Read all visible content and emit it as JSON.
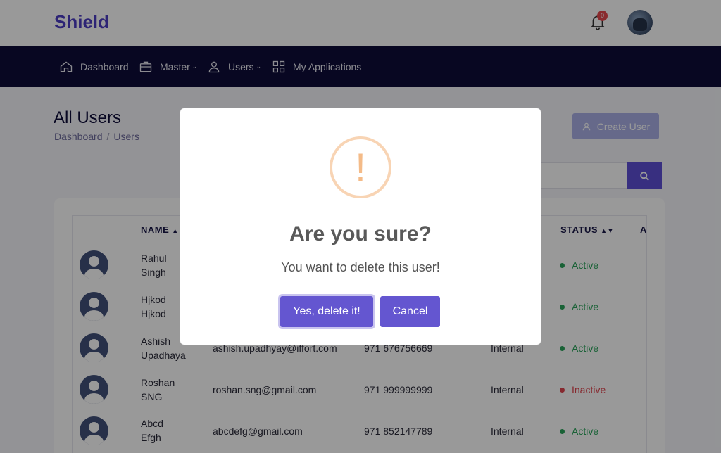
{
  "header": {
    "brand": "Shield",
    "notification_count": "0"
  },
  "nav": {
    "items": [
      {
        "label": "Dashboard",
        "icon": "home-icon"
      },
      {
        "label": "Master",
        "icon": "briefcase-icon",
        "has_dropdown": true
      },
      {
        "label": "Users",
        "icon": "user-icon",
        "has_dropdown": true
      },
      {
        "label": "My Applications",
        "icon": "grid-icon"
      }
    ]
  },
  "page": {
    "title": "All Users",
    "breadcrumb": [
      "Dashboard",
      "Users"
    ],
    "breadcrumb_sep": "/",
    "create_button": "Create User",
    "search_placeholder": ""
  },
  "table": {
    "headers": {
      "name": "NAME",
      "status": "STATUS",
      "action": "A"
    },
    "rows": [
      {
        "first": "Rahul",
        "last": "Singh",
        "email": "",
        "phone": "",
        "type": "",
        "status": "Active"
      },
      {
        "first": "Hjkod",
        "last": "Hjkod",
        "email": "",
        "phone": "",
        "type": "",
        "status": "Active"
      },
      {
        "first": "Ashish",
        "last": "Upadhaya",
        "email": "ashish.upadhyay@iffort.com",
        "phone": "971 676756669",
        "type": "Internal",
        "status": "Active"
      },
      {
        "first": "Roshan",
        "last": "SNG",
        "email": "roshan.sng@gmail.com",
        "phone": "971 999999999",
        "type": "Internal",
        "status": "Inactive"
      },
      {
        "first": "Abcd",
        "last": "Efgh",
        "email": "abcdefg@gmail.com",
        "phone": "971 852147789",
        "type": "Internal",
        "status": "Active"
      }
    ]
  },
  "modal": {
    "icon": "!",
    "title": "Are you sure?",
    "text": "You want to delete this user!",
    "confirm_label": "Yes, delete it!",
    "cancel_label": "Cancel"
  },
  "colors": {
    "brand": "#4c3cc4",
    "navbar": "#0e0c3a",
    "primary": "#6456d0",
    "active": "#2aa35a",
    "inactive": "#e0454f",
    "warning": "#f4bb88"
  }
}
